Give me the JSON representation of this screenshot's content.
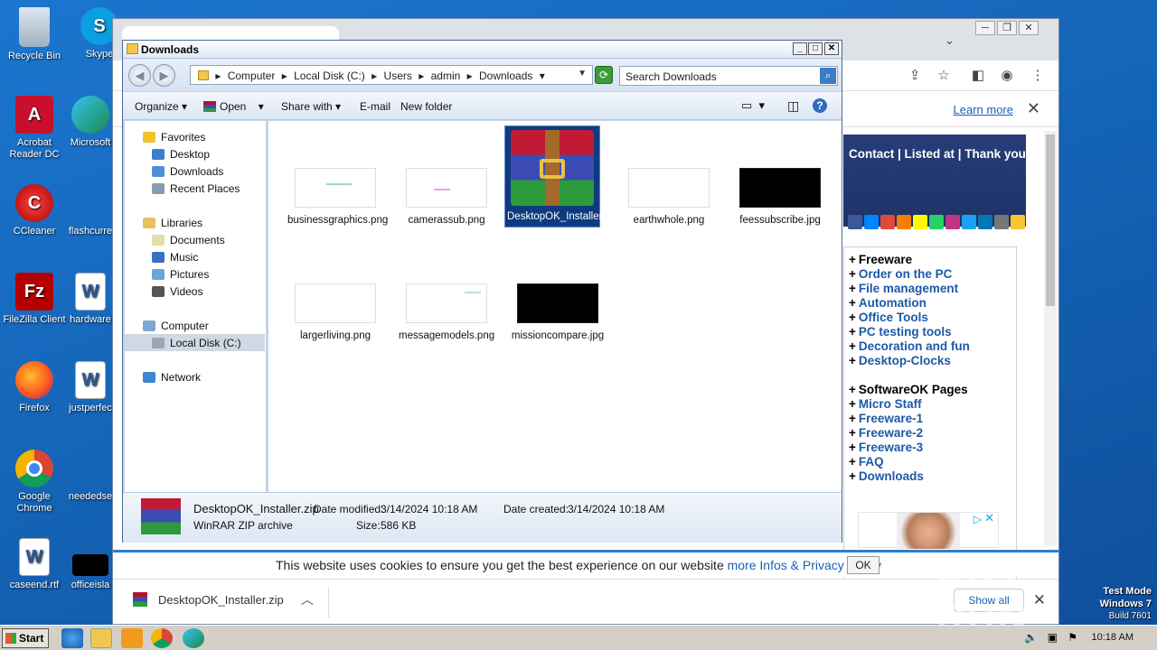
{
  "desktop": {
    "icons": [
      {
        "label": "Recycle Bin"
      },
      {
        "label": "Skype"
      },
      {
        "label": "Acrobat Reader DC"
      },
      {
        "label": "Microsoft"
      },
      {
        "label": "CCleaner"
      },
      {
        "label": "flashcurre"
      },
      {
        "label": "FileZilla Client"
      },
      {
        "label": "hardware"
      },
      {
        "label": "Firefox"
      },
      {
        "label": "justperfec"
      },
      {
        "label": "Google Chrome"
      },
      {
        "label": "neededse"
      },
      {
        "label": "caseend.rtf"
      },
      {
        "label": "officeisla"
      }
    ],
    "watermark": "ANY RUN",
    "test_mode": {
      "line1": "Test Mode",
      "line2": "Windows 7",
      "line3": "Build 7601"
    }
  },
  "browser": {
    "learn_more": "Learn more",
    "site_nav": "Contact | Listed at | Thank you",
    "menu": [
      {
        "text": "Freeware",
        "head": true
      },
      {
        "text": "Order on the PC"
      },
      {
        "text": "File management"
      },
      {
        "text": "Automation"
      },
      {
        "text": "Office Tools"
      },
      {
        "text": "PC testing tools"
      },
      {
        "text": "Decoration and fun"
      },
      {
        "text": "Desktop-Clocks"
      },
      {
        "text": "",
        "gap": true
      },
      {
        "text": "SoftwareOK Pages",
        "head": true
      },
      {
        "text": "Micro Staff"
      },
      {
        "text": "Freeware-1"
      },
      {
        "text": "Freeware-2"
      },
      {
        "text": "Freeware-3"
      },
      {
        "text": "FAQ"
      },
      {
        "text": "Downloads"
      }
    ],
    "cookie": {
      "text": "This website uses cookies to ensure you get the best experience on our website",
      "link": "more Infos & Privacy Policy",
      "ok": "OK"
    },
    "download_bar": {
      "file": "DesktopOK_Installer.zip",
      "show_all": "Show all"
    }
  },
  "explorer": {
    "title": "Downloads",
    "breadcrumbs": [
      "Computer",
      "Local Disk (C:)",
      "Users",
      "admin",
      "Downloads"
    ],
    "search_placeholder": "Search Downloads",
    "toolbar": {
      "organize": "Organize",
      "open": "Open",
      "share_with": "Share with",
      "email": "E-mail",
      "new_folder": "New folder"
    },
    "sidebar": {
      "favorites": "Favorites",
      "fav_items": [
        "Desktop",
        "Downloads",
        "Recent Places"
      ],
      "libraries": "Libraries",
      "lib_items": [
        "Documents",
        "Music",
        "Pictures",
        "Videos"
      ],
      "computer": "Computer",
      "local_disk": "Local Disk (C:)",
      "network": "Network"
    },
    "files": [
      {
        "name": "businessgraphics.png",
        "thumb": "light"
      },
      {
        "name": "camerassub.png",
        "thumb": "light"
      },
      {
        "name": "DesktopOK_Installer.zip",
        "thumb": "winrar",
        "selected": true
      },
      {
        "name": "earthwhole.png",
        "thumb": "light"
      },
      {
        "name": "feessubscribe.jpg",
        "thumb": "dark"
      },
      {
        "name": "largerliving.png",
        "thumb": "light"
      },
      {
        "name": "messagemodels.png",
        "thumb": "light"
      },
      {
        "name": "missioncompare.jpg",
        "thumb": "dark"
      }
    ],
    "status": {
      "name": "DesktopOK_Installer.zip",
      "type": "WinRAR ZIP archive",
      "modified_label": "Date modified:",
      "modified": "3/14/2024 10:18 AM",
      "created_label": "Date created:",
      "created": "3/14/2024 10:18 AM",
      "size_label": "Size:",
      "size": "586 KB"
    }
  },
  "taskbar": {
    "start": "Start",
    "clock": "10:18 AM"
  },
  "colors": {
    "desktop": "#1565b8",
    "selection": "#0e3a80",
    "link": "#1d59a6"
  }
}
